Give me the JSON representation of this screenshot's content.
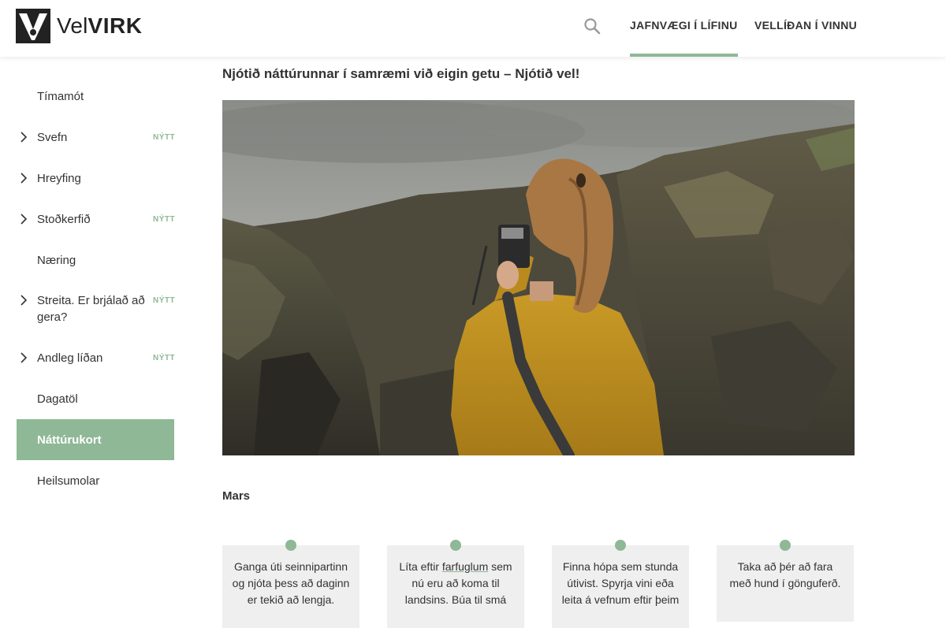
{
  "header": {
    "logo": {
      "vel": "Vel",
      "virk": "VIRK"
    },
    "search_icon": "search-icon",
    "nav": [
      {
        "label": "JAFNVÆGI Í LÍFINU",
        "active": true
      },
      {
        "label": "VELLÍÐAN Í VINNU",
        "active": false
      }
    ]
  },
  "sidebar": {
    "items": [
      {
        "label": "Tímamót",
        "has_chevron": false,
        "badge": ""
      },
      {
        "label": "Svefn",
        "has_chevron": true,
        "badge": "NÝTT"
      },
      {
        "label": "Hreyfing",
        "has_chevron": true,
        "badge": ""
      },
      {
        "label": "Stoðkerfið",
        "has_chevron": true,
        "badge": "NÝTT"
      },
      {
        "label": "Næring",
        "has_chevron": false,
        "badge": ""
      },
      {
        "label": "Streita. Er brjálað að gera?",
        "has_chevron": true,
        "badge": "NÝTT"
      },
      {
        "label": "Andleg líðan",
        "has_chevron": true,
        "badge": "NÝTT"
      },
      {
        "label": "Dagatöl",
        "has_chevron": false,
        "badge": ""
      },
      {
        "label": "Náttúrukort",
        "has_chevron": false,
        "badge": "",
        "active": true
      },
      {
        "label": "Heilsumolar",
        "has_chevron": false,
        "badge": ""
      }
    ]
  },
  "main": {
    "title": "Njótið náttúrunnar í samræmi við eigin getu – Njótið vel!",
    "section_title": "Mars",
    "cards": [
      {
        "text": "Ganga úti seinnipartinn og njóta þess að daginn er tekið að lengja."
      },
      {
        "text_before": "Líta eftir ",
        "link": "farfuglum",
        "text_after": " sem nú eru að koma til landsins. Búa til smá"
      },
      {
        "text": "Finna hópa sem stunda útivist. Spyrja vini eða leita á vefnum eftir þeim"
      },
      {
        "text": "Taka að þér að fara með hund í gönguferð."
      }
    ]
  },
  "colors": {
    "accent": "#8fb896",
    "card_bg": "#efefef",
    "text": "#333333"
  }
}
